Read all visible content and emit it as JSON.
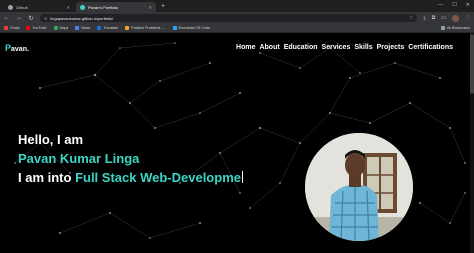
{
  "browser": {
    "tabs": [
      {
        "title": "Github",
        "active": false
      },
      {
        "title": "Pavan's Portfolio",
        "active": true
      }
    ],
    "new_tab": "+",
    "window_controls": {
      "minimize": "—",
      "maximize": "☐",
      "close": "✕"
    },
    "url": "lingapavankumar.github.io/portfolio/",
    "bookmarks": [
      {
        "label": "Gmail",
        "color": "#ea4335"
      },
      {
        "label": "YouTube",
        "color": "#ff0000"
      },
      {
        "label": "Maps",
        "color": "#34a853"
      },
      {
        "label": "News",
        "color": "#4285f4"
      },
      {
        "label": "Translate",
        "color": "#1a73e8"
      },
      {
        "label": "Practice Problems -...",
        "color": "#f5a623"
      },
      {
        "label": "Download VS Code",
        "color": "#23a9f2"
      }
    ],
    "all_bookmarks": "All Bookmarks"
  },
  "site": {
    "logo_first": "P",
    "logo_rest": "avan.",
    "nav": [
      "Home",
      "About",
      "Education",
      "Services",
      "Skills",
      "Projects",
      "Certifications"
    ],
    "hero": {
      "greeting": "Hello, I am",
      "name": "Pavan Kumar Linga",
      "prefix": "I am into ",
      "typed": "Full Stack Web-Developme"
    },
    "accent_color": "#3bd6c6"
  }
}
